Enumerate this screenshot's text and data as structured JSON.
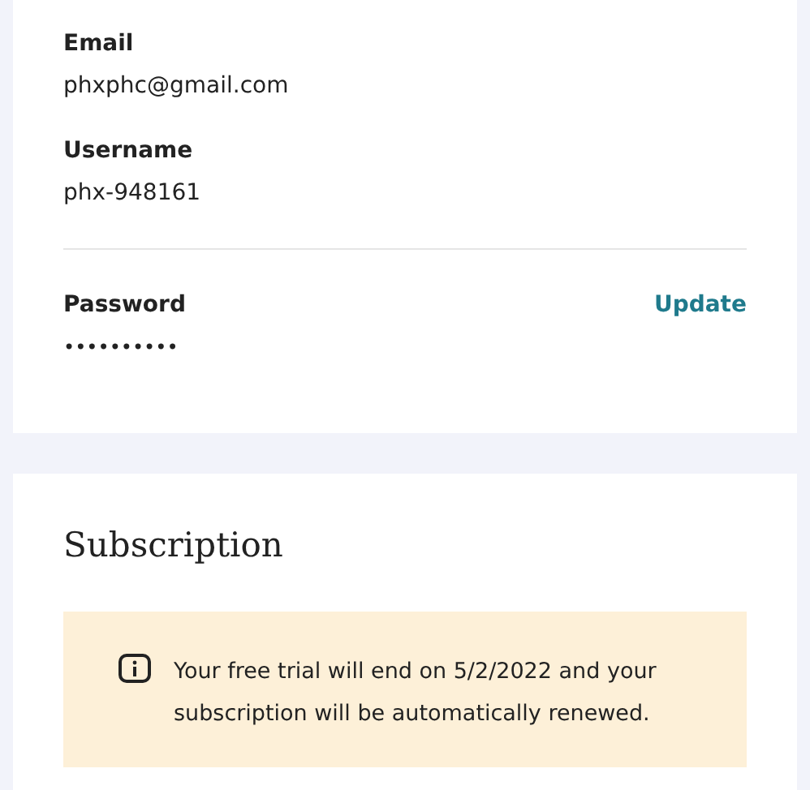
{
  "account": {
    "fields": [
      {
        "label": "Email",
        "value": "phxphc@gmail.com"
      },
      {
        "label": "Username",
        "value": "phx-948161"
      }
    ],
    "password": {
      "label": "Password",
      "value": "••••••••••",
      "action": "Update"
    }
  },
  "subscription": {
    "title": "Subscription",
    "notice": "Your free trial will end on 5/2/2022 and your subscription will be automatically renewed."
  }
}
